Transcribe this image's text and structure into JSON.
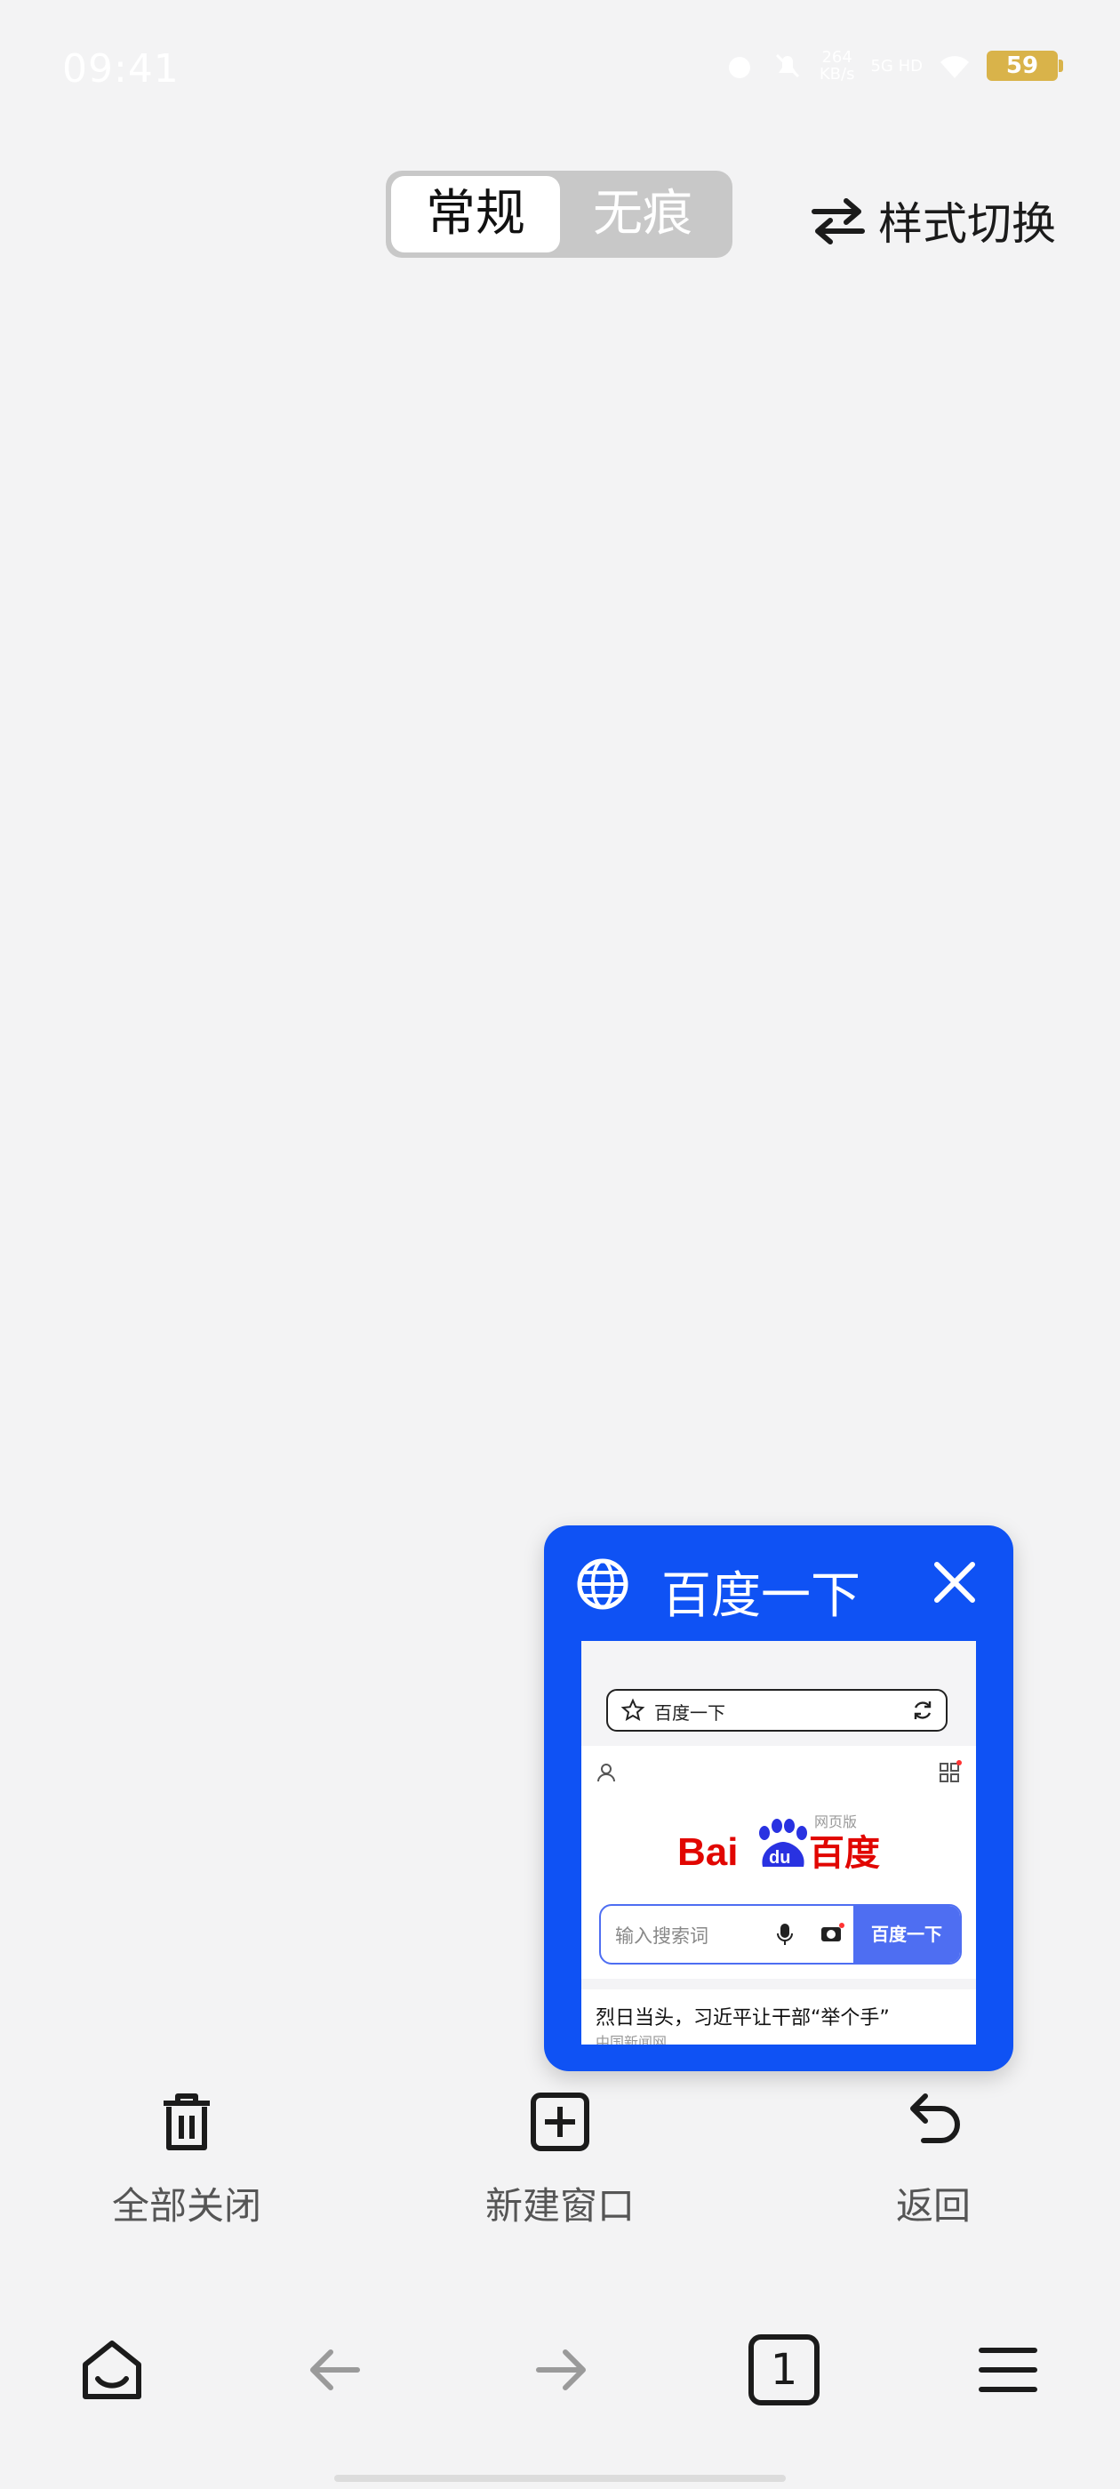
{
  "status_bar": {
    "time": "09:41",
    "net_speed_value": "264",
    "net_speed_unit": "KB/s",
    "signal_label": "5G HD",
    "battery": "59",
    "battery_color": "#d9b34a"
  },
  "mode_tabs": {
    "normal": "常规",
    "private": "无痕"
  },
  "style_switch": {
    "label": "样式切换"
  },
  "tab_card": {
    "title": "百度一下",
    "accent": "#0f52f4",
    "preview": {
      "search_text": "百度一下",
      "logo_alt": "Bai du 百度",
      "web_version": "网页版",
      "placeholder": "输入搜索词",
      "search_button": "百度一下",
      "news_title": "烈日当头，习近平让干部“举个手”",
      "news_source": "中国新闻网"
    }
  },
  "actions": {
    "close_all": "全部关闭",
    "new_window": "新建窗口",
    "back": "返回"
  },
  "bottom_nav": {
    "tab_count": "1"
  }
}
